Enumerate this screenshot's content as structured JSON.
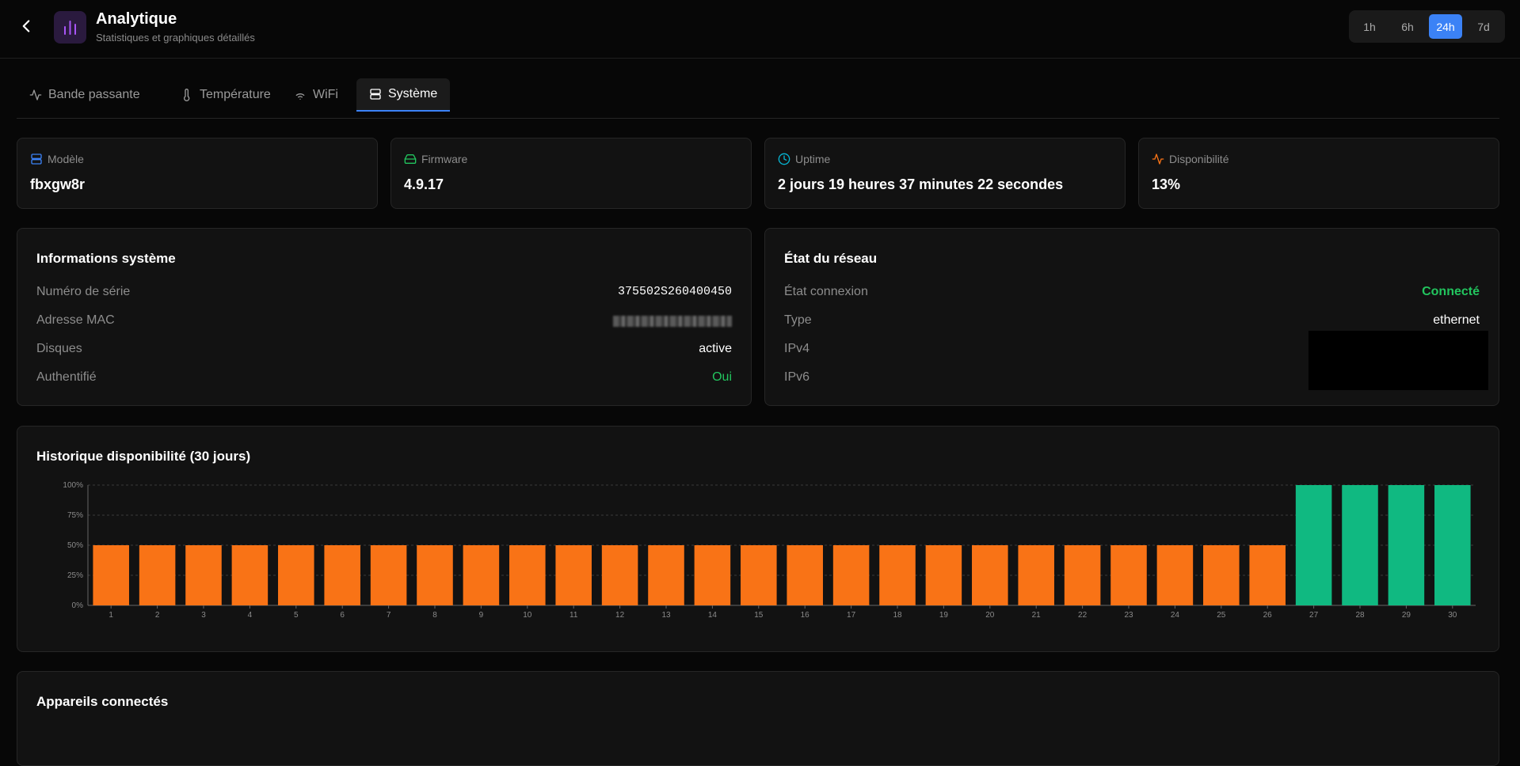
{
  "header": {
    "title": "Analytique",
    "subtitle": "Statistiques et graphiques détaillés",
    "back_icon": "chevron-left-icon",
    "app_icon": "bar-chart-icon",
    "app_icon_color": "#a855f7",
    "time_ranges": [
      "1h",
      "6h",
      "24h",
      "7d"
    ],
    "active_range": "24h"
  },
  "tabs": [
    {
      "label": "Bande passante",
      "icon": "activity-icon"
    },
    {
      "label": "Température",
      "icon": "thermometer-icon"
    },
    {
      "label": "WiFi",
      "icon": "wifi-icon"
    },
    {
      "label": "Système",
      "icon": "server-icon",
      "active": true
    }
  ],
  "stats": [
    {
      "label": "Modèle",
      "value": "fbxgw8r",
      "icon": "server-icon",
      "color": "#3b82f6"
    },
    {
      "label": "Firmware",
      "value": "4.9.17",
      "icon": "hard-drive-icon",
      "color": "#22c55e"
    },
    {
      "label": "Uptime",
      "value": "2 jours 19 heures 37 minutes 22 secondes",
      "icon": "clock-icon",
      "color": "#06b6d4"
    },
    {
      "label": "Disponibilité",
      "value": "13%",
      "icon": "activity-icon",
      "color": "#f97316"
    }
  ],
  "system_info": {
    "title": "Informations système",
    "rows": [
      {
        "key": "Numéro de série",
        "value": "375502S260400450"
      },
      {
        "key": "Adresse MAC",
        "value": ""
      },
      {
        "key": "Disques",
        "value": "active"
      },
      {
        "key": "Authentifié",
        "value": "Oui"
      }
    ]
  },
  "network": {
    "title": "État du réseau",
    "rows": [
      {
        "key": "État connexion",
        "value": "Connecté"
      },
      {
        "key": "Type",
        "value": "ethernet"
      },
      {
        "key": "IPv4",
        "value": ""
      },
      {
        "key": "IPv6",
        "value": ""
      }
    ]
  },
  "availability": {
    "title": "Historique disponibilité (30 jours)",
    "colors": {
      "low": "#f97316",
      "full": "#10b981",
      "grid": "#3a3a3a",
      "axis": "#666666"
    }
  },
  "chart_data": {
    "type": "bar",
    "categories": [
      "1",
      "2",
      "3",
      "4",
      "5",
      "6",
      "7",
      "8",
      "9",
      "10",
      "11",
      "12",
      "13",
      "14",
      "15",
      "16",
      "17",
      "18",
      "19",
      "20",
      "21",
      "22",
      "23",
      "24",
      "25",
      "26",
      "27",
      "28",
      "29",
      "30"
    ],
    "values": [
      50,
      50,
      50,
      50,
      50,
      50,
      50,
      50,
      50,
      50,
      50,
      50,
      50,
      50,
      50,
      50,
      50,
      50,
      50,
      50,
      50,
      50,
      50,
      50,
      50,
      50,
      100,
      100,
      100,
      100
    ],
    "yticks": [
      "0%",
      "25%",
      "50%",
      "75%",
      "100%"
    ],
    "ylim": [
      0,
      100
    ],
    "grid": true
  },
  "devices": {
    "title": "Appareils connectés"
  }
}
